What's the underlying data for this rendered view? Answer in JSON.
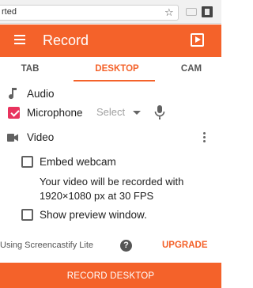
{
  "browser": {
    "url_fragment": "rted",
    "star_icon": "star-icon"
  },
  "header": {
    "title": "Record",
    "menu_icon": "hamburger-menu-icon",
    "logo_icon": "screencastify-logo-icon"
  },
  "tabs": [
    {
      "label": "TAB",
      "active": false
    },
    {
      "label": "DESKTOP",
      "active": true
    },
    {
      "label": "CAM",
      "active": false
    }
  ],
  "audio": {
    "title": "Audio",
    "microphone_label": "Microphone",
    "microphone_checked": true,
    "select_value": "Select"
  },
  "video": {
    "title": "Video",
    "embed_webcam_label": "Embed webcam",
    "embed_webcam_checked": false,
    "info_text": "Your video will be recorded with 1920×1080 px at 30 FPS",
    "show_preview_label": "Show preview window.",
    "show_preview_checked": false
  },
  "footer": {
    "lite_text": "Using Screencastify Lite",
    "help_icon_glyph": "?",
    "upgrade_label": "UPGRADE"
  },
  "record_button_label": "RECORD DESKTOP",
  "colors": {
    "accent": "#f4622a",
    "checkbox_checked": "#e8335e"
  }
}
